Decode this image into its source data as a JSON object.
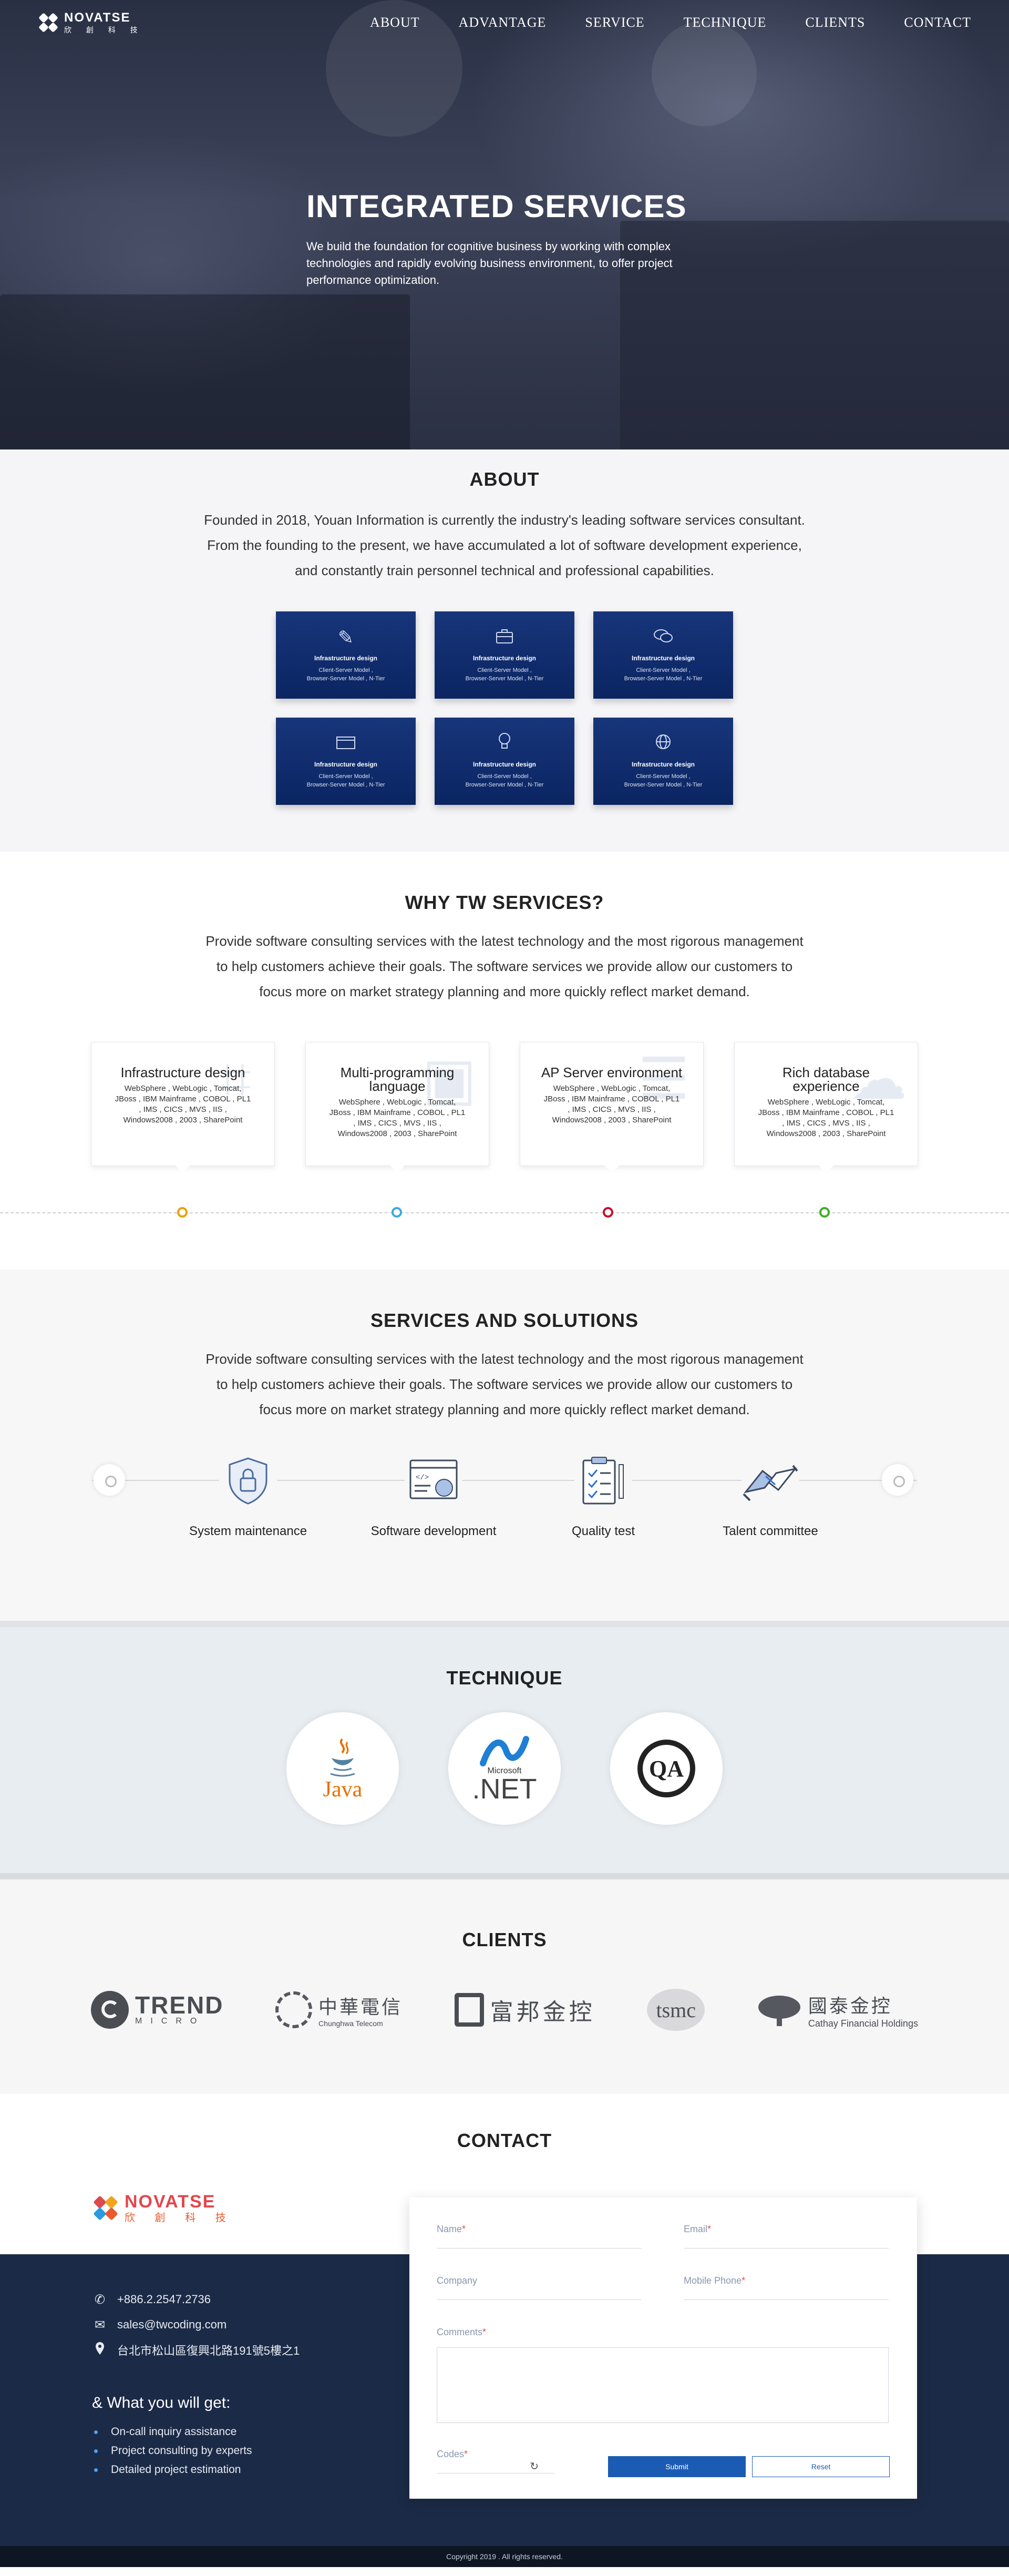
{
  "nav": {
    "logo_name": "NOVATSE",
    "logo_sub": "欣 創 科 技",
    "links": [
      "ABOUT",
      "ADVANTAGE",
      "SERVICE",
      "TECHNIQUE",
      "CLIENTS",
      "CONTACT"
    ]
  },
  "hero": {
    "title": "INTEGRATED SERVICES",
    "body": "We build the foundation for cognitive business by working with complex technologies and rapidly evolving business environment, to offer project performance optimization."
  },
  "about": {
    "title": "ABOUT",
    "lines": [
      "Founded in 2018, Youan Information is currently the industry's leading software services consultant.",
      "From the founding to the present, we have accumulated a lot of software development experience,",
      "and constantly train personnel technical and professional capabilities."
    ],
    "cards": [
      {
        "icon": "pen-icon",
        "glyph": "✎",
        "title": "Infrastructure design",
        "line1": "Client-Server Model ,",
        "line2": "Browser-Server Model , N-Tier"
      },
      {
        "icon": "briefcase-icon",
        "glyph": "💼",
        "title": "Infrastructure design",
        "line1": "Client-Server Model ,",
        "line2": "Browser-Server Model , N-Tier"
      },
      {
        "icon": "chat-icon",
        "glyph": "💬",
        "title": "Infrastructure design",
        "line1": "Client-Server Model ,",
        "line2": "Browser-Server Model , N-Tier"
      },
      {
        "icon": "folder-icon",
        "glyph": "🗂",
        "title": "Infrastructure design",
        "line1": "Client-Server Model ,",
        "line2": "Browser-Server Model , N-Tier"
      },
      {
        "icon": "lightbulb-icon",
        "glyph": "💡",
        "title": "Infrastructure design",
        "line1": "Client-Server Model ,",
        "line2": "Browser-Server Model , N-Tier"
      },
      {
        "icon": "globe-icon",
        "glyph": "🌐",
        "title": "Infrastructure design",
        "line1": "Client-Server Model ,",
        "line2": "Browser-Server Model , N-Tier"
      }
    ]
  },
  "why": {
    "title": "WHY TW SERVICES?",
    "lines": [
      "Provide software consulting services with the latest technology and the most rigorous management",
      "to help customers achieve their goals. The software services we provide allow our customers to",
      "focus more on market strategy planning and more quickly reflect market demand."
    ],
    "cards": [
      {
        "title": "Infrastructure design",
        "text": "WebSphere , WebLogic , Tomcat, JBoss , IBM Mainframe , COBOL , PL1 , IMS , CICS , MVS , IIS , Windows2008 , 2003 , SharePoint",
        "dot_color": "#e8a300"
      },
      {
        "title": "Multi-programming language",
        "text": "WebSphere , WebLogic , Tomcat, JBoss , IBM Mainframe , COBOL , PL1 , IMS , CICS , MVS , IIS , Windows2008 , 2003 , SharePoint",
        "dot_color": "#3aa9e0"
      },
      {
        "title": "AP Server environment",
        "text": "WebSphere , WebLogic , Tomcat, JBoss , IBM Mainframe , COBOL , PL1 , IMS , CICS , MVS , IIS , Windows2008 , 2003 , SharePoint",
        "dot_color": "#c8102e"
      },
      {
        "title": "Rich database experience",
        "text": "WebSphere , WebLogic , Tomcat, JBoss , IBM Mainframe , COBOL , PL1 , IMS , CICS , MVS , IIS , Windows2008 , 2003 , SharePoint",
        "dot_color": "#3fae29"
      }
    ]
  },
  "services": {
    "title": "SERVICES AND SOLUTIONS",
    "lines": [
      "Provide software consulting services with the latest technology and the most rigorous management",
      "to help customers achieve their goals. The software services we provide allow our customers to",
      "focus more on market strategy planning and more quickly reflect market demand."
    ],
    "items": [
      {
        "label": "System maintenance",
        "icon": "shield-lock-icon"
      },
      {
        "label": "Software development",
        "icon": "code-window-icon"
      },
      {
        "label": "Quality test",
        "icon": "clipboard-check-icon"
      },
      {
        "label": "Talent committee",
        "icon": "handshake-icon"
      }
    ]
  },
  "technique": {
    "title": "TECHNIQUE",
    "java": "Java",
    "net_small": "Microsoft",
    "net_big": ".NET",
    "qa": "QA"
  },
  "clients": {
    "title": "CLIENTS",
    "trend_big": "TREND",
    "trend_small": "MICRO",
    "cht_big": "中華電信",
    "cht_small": "Chunghwa Telecom",
    "fubon": "富邦金控",
    "tsmc": "tsmc",
    "cathay_big": "國泰金控",
    "cathay_small": "Cathay Financial Holdings"
  },
  "contact": {
    "title": "CONTACT",
    "phone": "+886.2.2547.2736",
    "email": "sales@twcoding.com",
    "address": "台北市松山區復興北路191號5樓之1",
    "get_title": "& What you will get:",
    "get_items": [
      "On-call inquiry assistance",
      "Project consulting by experts",
      "Detailed project estimation"
    ],
    "form": {
      "name": "Name",
      "email": "Email",
      "company": "Company",
      "mobile": "Mobile Phone",
      "comments": "Comments",
      "codes": "Codes",
      "refresh": "↻",
      "submit": "Submit",
      "reset": "Reset"
    }
  },
  "footer": {
    "copyright": "Copyright 2019 . All rights reserved."
  }
}
